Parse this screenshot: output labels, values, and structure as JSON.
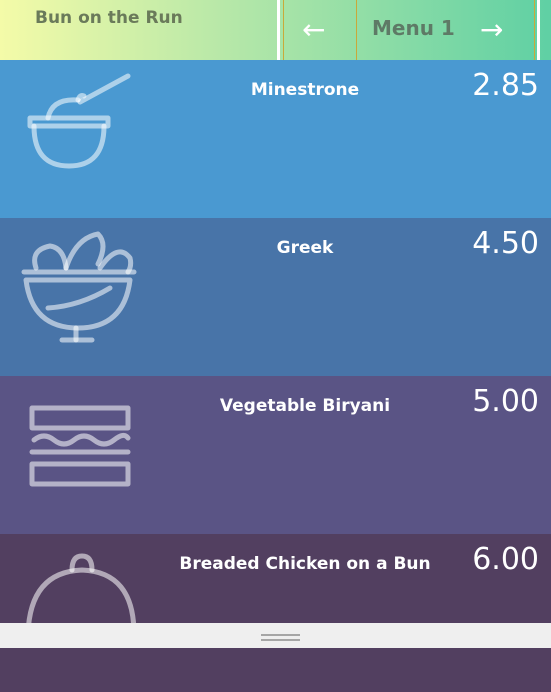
{
  "header": {
    "brand": "Bun on the Run",
    "menu_title": "Menu 1",
    "prev_arrow": "←",
    "next_arrow": "→",
    "gradient": [
      "#f4fba8",
      "#5fd0a4"
    ]
  },
  "items": [
    {
      "name": "Minestrone",
      "price": "2.85",
      "icon": "soup-bowl-icon",
      "color": "#4a99d1"
    },
    {
      "name": "Greek",
      "price": "4.50",
      "icon": "salad-bowl-icon",
      "color": "#4874a8"
    },
    {
      "name": "Vegetable Biryani",
      "price": "5.00",
      "icon": "sandwich-icon",
      "color": "#5a5485"
    },
    {
      "name": "Breaded Chicken on a Bun",
      "price": "6.00",
      "icon": "cloche-icon",
      "color": "#523f60"
    }
  ],
  "colors": {
    "icon_stroke": "rgba(255,255,255,0.55)"
  }
}
